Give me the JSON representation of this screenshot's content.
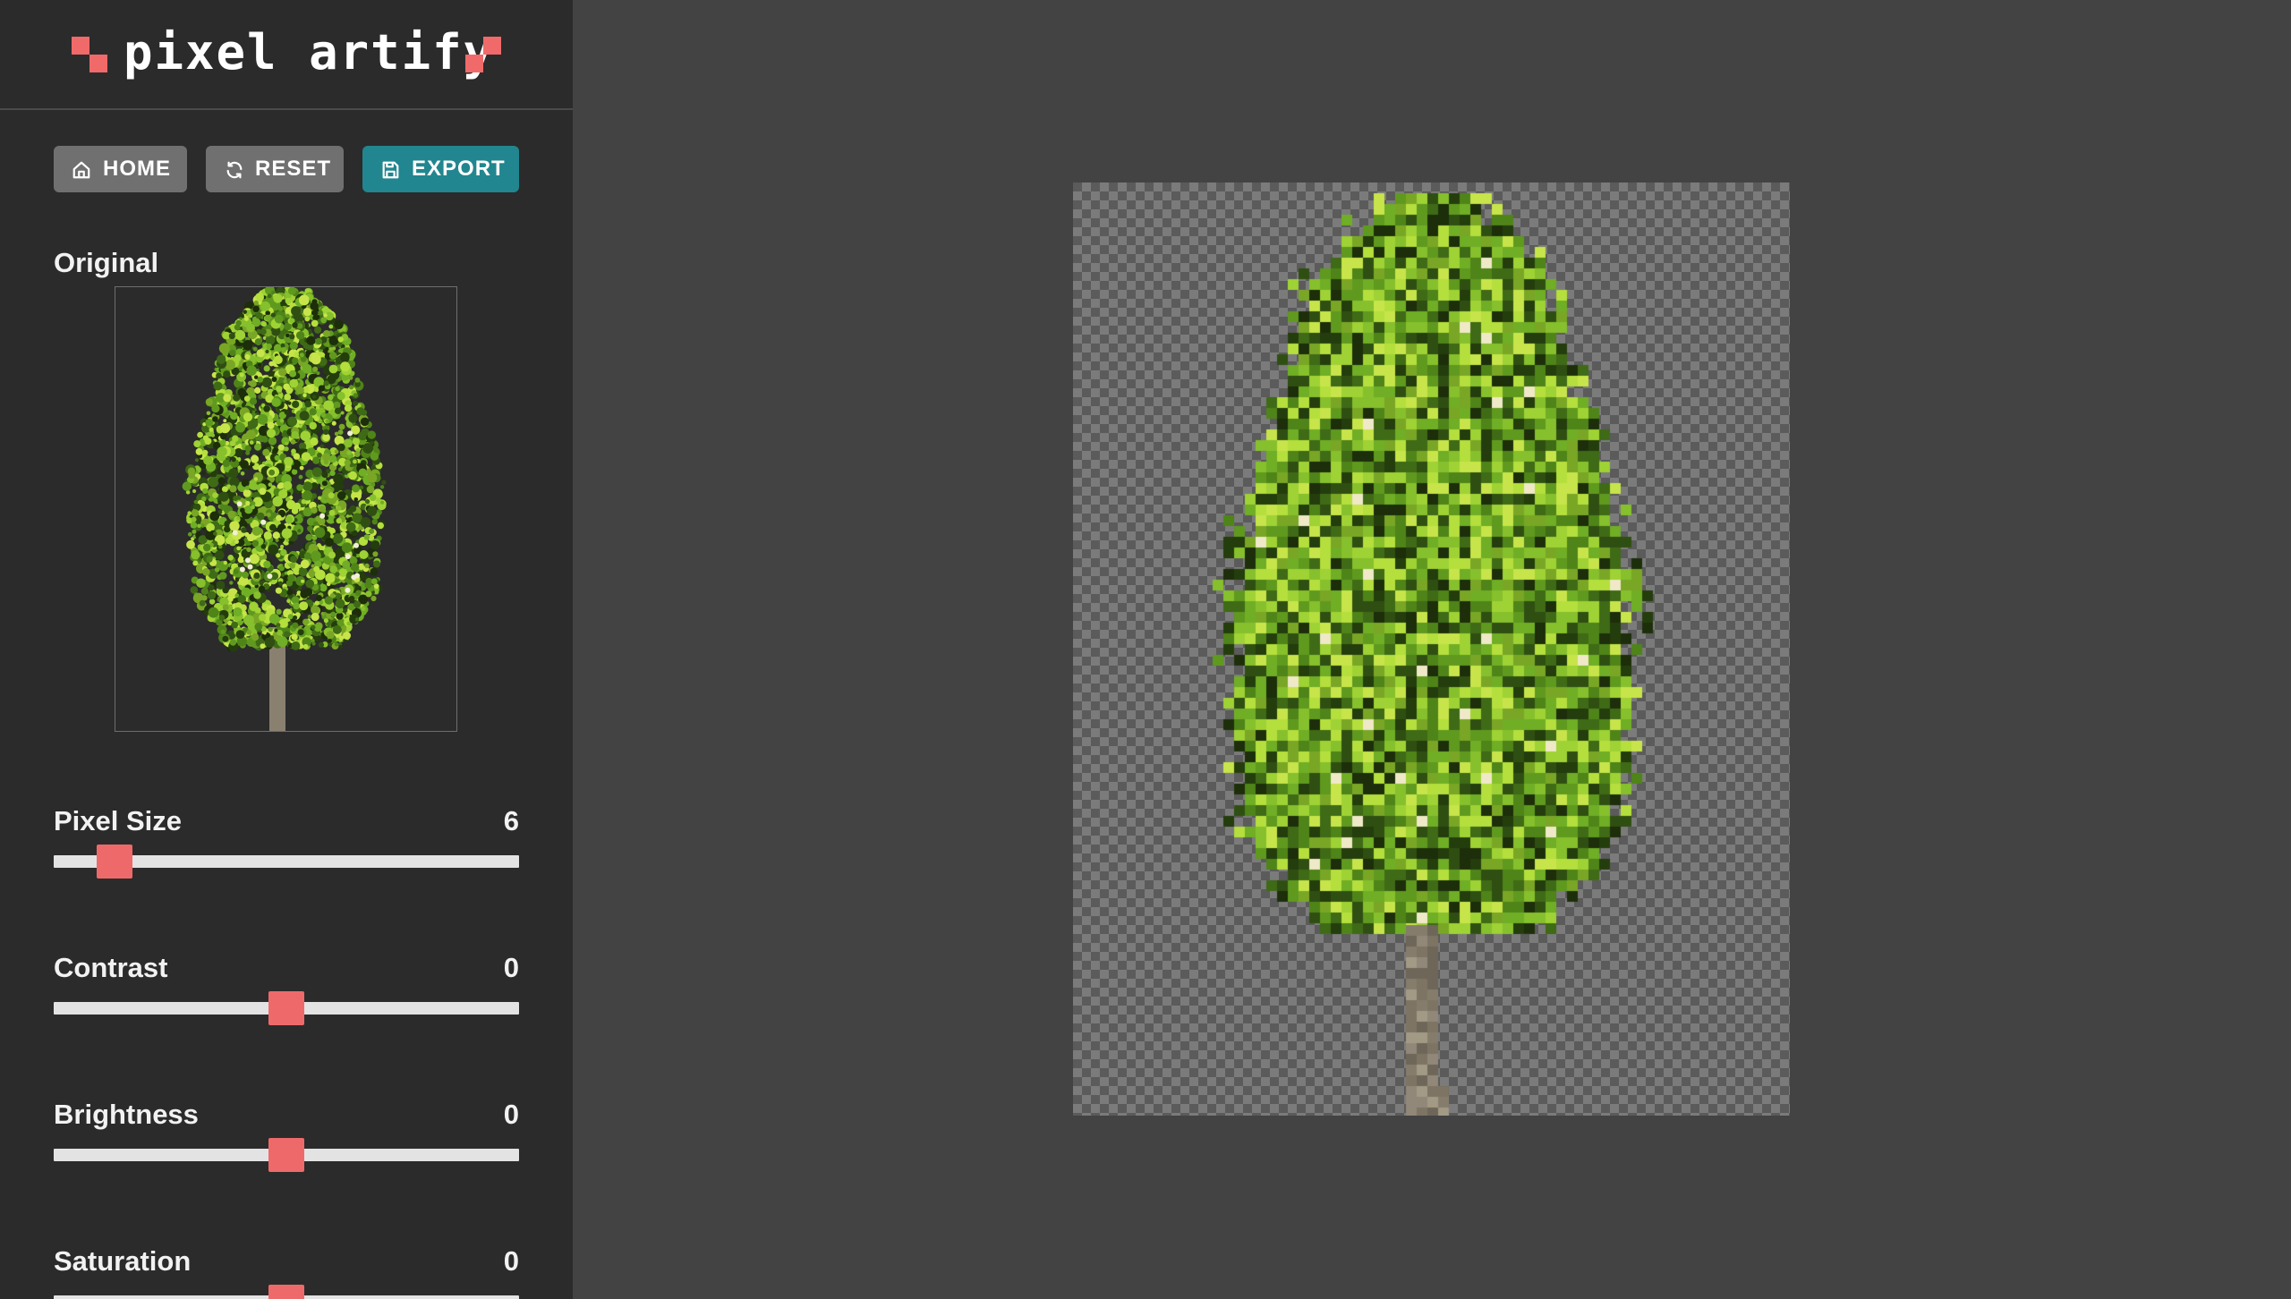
{
  "app": {
    "title": "pixel artify",
    "accent": "#f06a6a",
    "export_color": "#21868f"
  },
  "toolbar": {
    "home_label": "HOME",
    "reset_label": "RESET",
    "export_label": "EXPORT"
  },
  "original": {
    "label": "Original"
  },
  "controls": {
    "pixel_size": {
      "label": "Pixel Size",
      "value": "6",
      "fraction": 0.13
    },
    "contrast": {
      "label": "Contrast",
      "value": "0",
      "fraction": 0.5
    },
    "brightness": {
      "label": "Brightness",
      "value": "0",
      "fraction": 0.5
    },
    "saturation": {
      "label": "Saturation",
      "value": "0",
      "fraction": 0.5
    }
  }
}
